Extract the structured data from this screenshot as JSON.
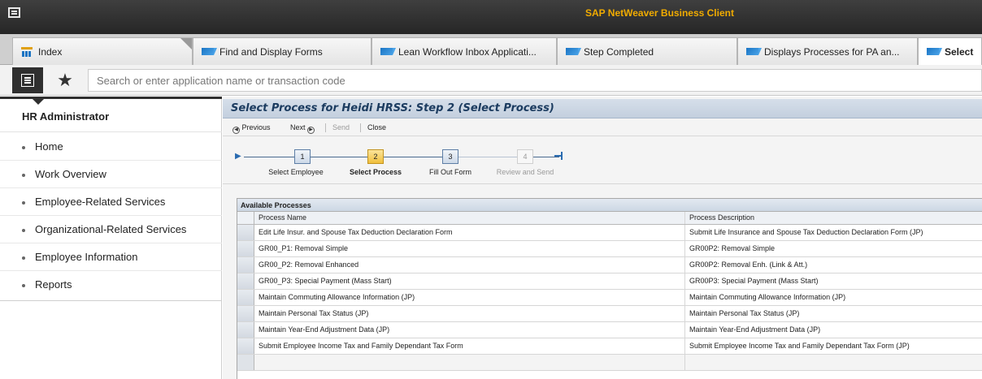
{
  "app": {
    "title": "SAP NetWeaver Business Client"
  },
  "tabs": [
    {
      "label": "Index",
      "icon": "index-icon"
    },
    {
      "label": "Find and Display Forms",
      "icon": "sap-icon"
    },
    {
      "label": "Lean Workflow Inbox Applicati...",
      "icon": "sap-icon"
    },
    {
      "label": "Step Completed",
      "icon": "sap-icon"
    },
    {
      "label": "Displays Processes for PA an...",
      "icon": "sap-icon"
    },
    {
      "label": "Select",
      "icon": "sap-icon"
    }
  ],
  "search": {
    "placeholder": "Search or enter application name or transaction code",
    "favorites_icon": "★"
  },
  "sidebar": {
    "title": "HR Administrator",
    "items": [
      {
        "label": "Home"
      },
      {
        "label": "Work Overview"
      },
      {
        "label": "Employee-Related Services"
      },
      {
        "label": "Organizational-Related Services"
      },
      {
        "label": "Employee Information"
      },
      {
        "label": "Reports"
      }
    ]
  },
  "page": {
    "title": "Select Process for Heidi HRSS: Step 2 (Select Process)",
    "toolbar": {
      "previous": "Previous",
      "next": "Next",
      "send": "Send",
      "close": "Close"
    }
  },
  "roadmap": {
    "steps": [
      {
        "number": "1",
        "label": "Select Employee",
        "state": "done"
      },
      {
        "number": "2",
        "label": "Select Process",
        "state": "current"
      },
      {
        "number": "3",
        "label": "Fill Out Form",
        "state": "todo"
      },
      {
        "number": "4",
        "label": "Review and Send",
        "state": "disabled"
      }
    ]
  },
  "table": {
    "caption": "Available Processes",
    "columns": [
      "Process Name",
      "Process Description"
    ],
    "rows": [
      {
        "name": "Edit Life Insur. and Spouse Tax Deduction Declaration Form",
        "description": "Submit Life Insurance and Spouse Tax Deduction Declaration Form (JP)"
      },
      {
        "name": "GR00_P1: Removal Simple",
        "description": "GR00P2: Removal Simple"
      },
      {
        "name": "GR00_P2: Removal Enhanced",
        "description": "GR00P2: Removal Enh. (Link & Att.)"
      },
      {
        "name": "GR00_P3: Special Payment (Mass Start)",
        "description": "GR00P3: Special Payment (Mass Start)"
      },
      {
        "name": "Maintain Commuting Allowance Information (JP)",
        "description": "Maintain Commuting Allowance Information (JP)"
      },
      {
        "name": "Maintain Personal Tax Status (JP)",
        "description": "Maintain Personal Tax Status (JP)"
      },
      {
        "name": "Maintain Year-End Adjustment Data (JP)",
        "description": "Maintain Year-End Adjustment Data (JP)"
      },
      {
        "name": "Submit Employee Income Tax and Family Dependant Tax Form",
        "description": "Submit Employee Income Tax and Family Dependant Tax Form (JP)"
      }
    ]
  },
  "colors": {
    "title_text": "#f0ab00",
    "titlebar_bg": "#2f2f2f",
    "current_step": "#f0bf3c",
    "header_text": "#1c3c60"
  }
}
